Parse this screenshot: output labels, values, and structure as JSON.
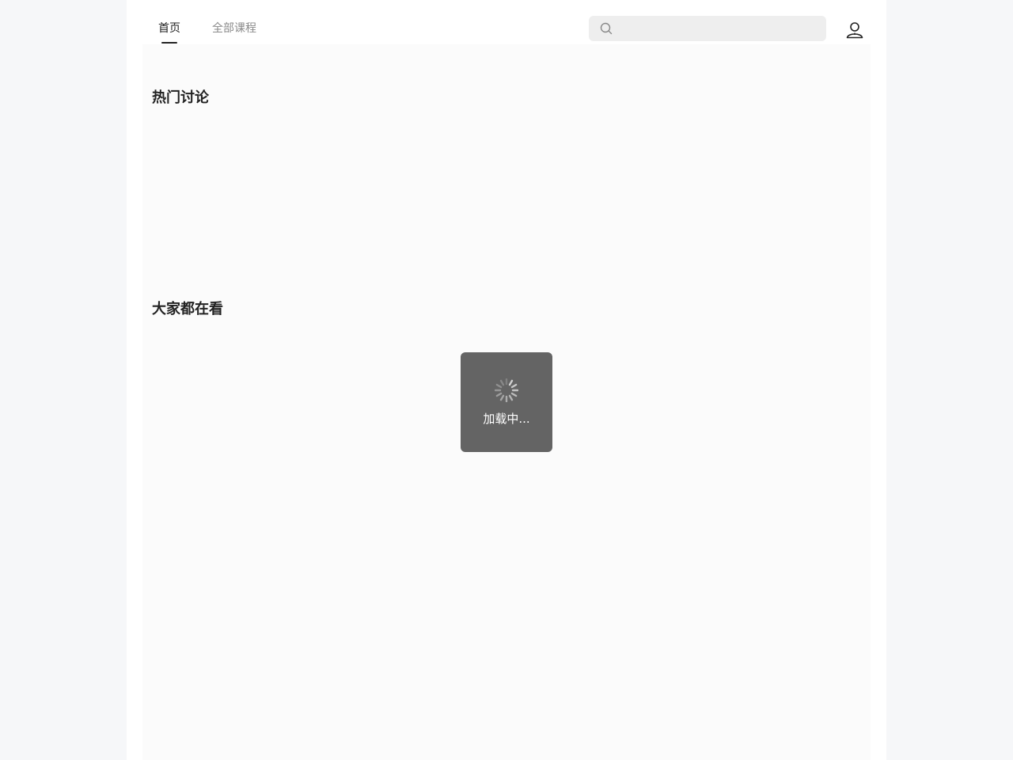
{
  "nav": {
    "tabs": [
      {
        "label": "首页",
        "active": true
      },
      {
        "label": "全部课程",
        "active": false
      }
    ]
  },
  "search": {
    "icon": "search-icon",
    "placeholder": "",
    "value": ""
  },
  "user": {
    "icon": "user-icon"
  },
  "sections": {
    "hot_discussions": {
      "title": "热门讨论"
    },
    "everyone_watching": {
      "title": "大家都在看"
    }
  },
  "loading": {
    "text": "加载中...",
    "icon": "spinner-icon"
  },
  "colors": {
    "active_tab": "#222222",
    "inactive_tab": "#8a8a8a",
    "toast_bg": "#646464",
    "search_bg": "#eeeeee"
  }
}
